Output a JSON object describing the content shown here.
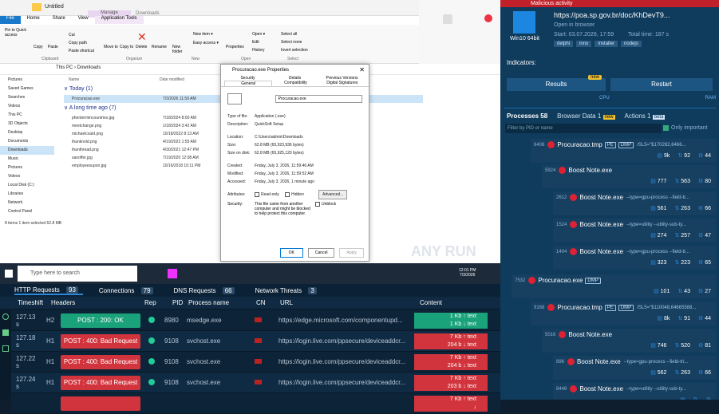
{
  "explorer": {
    "title": "Untitled",
    "manage": "Manage",
    "downloads_title": "Downloads",
    "tabs": [
      "File",
      "Home",
      "Share",
      "View",
      "Application Tools"
    ],
    "ribbon": {
      "pin": "Pin to Quick access",
      "copy": "Copy",
      "paste": "Paste",
      "cut": "Cut",
      "copy_path": "Copy path",
      "paste_shortcut": "Paste shortcut",
      "move_to": "Move to",
      "copy_to": "Copy to",
      "delete": "Delete",
      "rename": "Rename",
      "new_folder": "New folder",
      "new_item": "New item ▾",
      "easy_access": "Easy access ▾",
      "properties": "Properties",
      "open": "Open ▾",
      "edit": "Edit",
      "history": "History",
      "select_all": "Select all",
      "select_none": "Select none",
      "invert": "Invert selection",
      "groups": [
        "Clipboard",
        "Organize",
        "New",
        "Open",
        "Select"
      ]
    },
    "path": "This PC › Downloads",
    "nav": [
      "Pictures",
      "Saved Games",
      "Searches",
      "Videos",
      "This PC",
      "3D Objects",
      "Desktop",
      "Documents",
      "Downloads",
      "Music",
      "Pictures",
      "Videos",
      "Local Disk (C:)",
      "Libraries",
      "Network",
      "Control Panel"
    ],
    "headers": [
      "Name",
      "Date modified"
    ],
    "group_today": "∨ Today (1)",
    "group_old": "∨ A long time ago (7)",
    "files_today": [
      [
        "Procuracao.exe",
        "7/3/2026 11:59 AM"
      ]
    ],
    "files_old": [
      [
        "phentermincountries.jpg",
        "7/18/2024 8:00 AM"
      ],
      [
        "meetchange.png",
        "1/18/2024 3:42 AM"
      ],
      [
        "michaelcould.png",
        "10/18/2022 8:13 AM"
      ],
      [
        "thanknoid.png",
        "4/19/2022 1:55 AM"
      ],
      [
        "thanthread.png",
        "4/30/2021 12:47 PM"
      ],
      [
        "sanoffer.jpg",
        "7/19/2020 12:08 AM"
      ],
      [
        "employeesupon.jpg",
        "10/16/2018 10:11 PM"
      ]
    ],
    "status": "8 items    1 item selected  62.8 MB"
  },
  "dialog": {
    "title": "Procuracao.exe Properties",
    "tabs_top": [
      "Security",
      "Details",
      "Previous Versions"
    ],
    "tabs_bottom": [
      "General",
      "Compatibility",
      "Digital Signatures"
    ],
    "name": "Procuracao.exe",
    "props": [
      [
        "Type of file:",
        "Application (.exe)"
      ],
      [
        "Description:",
        "QuickSoft Setup"
      ],
      [
        "Location:",
        "C:\\Users\\admin\\Downloads"
      ],
      [
        "Size:",
        "62.8 MB (65,923,936 bytes)"
      ],
      [
        "Size on disk:",
        "62.8 MB (65,925,120 bytes)"
      ],
      [
        "Created:",
        "Friday, July 3, 2026, 11:59:46 AM"
      ],
      [
        "Modified:",
        "Friday, July 3, 2026, 11:59:52 AM"
      ],
      [
        "Accessed:",
        "Friday, July 3, 2026, 1 minute ago"
      ]
    ],
    "attr_label": "Attributes:",
    "readonly": "Read-only",
    "hidden": "Hidden",
    "advanced": "Advanced...",
    "security_label": "Security:",
    "security_text": "This file came from another computer and might be blocked to help protect this computer.",
    "unblock": "Unblock",
    "ok": "OK",
    "cancel": "Cancel",
    "apply": "Apply"
  },
  "taskbar": {
    "search": "Type here to search",
    "time": "12:01 PM",
    "date": "7/3/2026",
    "watermark": "ANY RUN"
  },
  "panel": {
    "malicious": "Malicious activity",
    "url": "https://poa.sp.gov.br/doc/KhDevT9...",
    "open_in": "Open in browser",
    "start": "Start: 03.07.2026, 17:59",
    "total": "Total time: 187 s",
    "os": "Win10 64bit",
    "tags": [
      "delphi",
      "inno",
      "installer",
      "nodejs"
    ],
    "indicators": "Indicators:",
    "results": "Results",
    "new": "new",
    "restart": "Restart",
    "cpu": "CPU",
    "ram": "RAM",
    "tabs": [
      "Processes 58",
      "Browser Data 1",
      "Actions 1"
    ],
    "beta": "beta",
    "filter": "Filter by PID or name",
    "only": "Only important",
    "procs": [
      {
        "pid": "6408",
        "name": "Procuracao.tmp",
        "chips": [
          "PE",
          "DMP"
        ],
        "args": "/SL5=\"$170282,6466...",
        "f": "9k",
        "n": "92",
        "g": "44"
      },
      {
        "pid": "5924",
        "name": "Boost Note.exe",
        "chips": [],
        "args": "",
        "f": "777",
        "n": "563",
        "g": "80"
      },
      {
        "pid": "2612",
        "name": "Boost Note.exe",
        "chips": [],
        "args": "--type=gpu-process --field-tr...",
        "f": "561",
        "n": "263",
        "g": "66"
      },
      {
        "pid": "1524",
        "name": "Boost Note.exe",
        "chips": [],
        "args": "--type=utility --utility-sub-ty...",
        "f": "274",
        "n": "257",
        "g": "47"
      },
      {
        "pid": "1404",
        "name": "Boost Note.exe",
        "chips": [],
        "args": "--type=gpu-process --field-tr...",
        "f": "323",
        "n": "223",
        "g": "65"
      },
      {
        "pid": "7532",
        "name": "Procuracao.exe",
        "chips": [
          "DMP"
        ],
        "args": "",
        "f": "101",
        "n": "43",
        "g": "27"
      },
      {
        "pid": "9168",
        "name": "Procuracao.tmp",
        "chips": [
          "PE",
          "DMP"
        ],
        "args": "/SL5=\"$110048,64665588...",
        "f": "8k",
        "n": "91",
        "g": "44"
      },
      {
        "pid": "5016",
        "name": "Boost Note.exe",
        "chips": [],
        "args": "",
        "f": "746",
        "n": "520",
        "g": "81"
      },
      {
        "pid": "896",
        "name": "Boost Note.exe",
        "chips": [],
        "args": "--type=gpu-process --field-tri...",
        "f": "562",
        "n": "263",
        "g": "66"
      },
      {
        "pid": "8448",
        "name": "Boost Note.exe",
        "chips": [],
        "args": "--type=utility --utility-sub-ty...",
        "f": "",
        "n": "",
        "g": ""
      }
    ]
  },
  "net": {
    "tabs": [
      [
        "HTTP Requests",
        "93"
      ],
      [
        "Connections",
        "79"
      ],
      [
        "DNS Requests",
        "66"
      ],
      [
        "Network Threats",
        "3"
      ]
    ],
    "headers": [
      "Timeshift",
      "Headers",
      "Rep",
      "PID",
      "Process name",
      "CN",
      "URL",
      "Content"
    ],
    "rows": [
      [
        "127.13 s",
        "H2",
        "POST : 200: OK",
        "8980",
        "msedge.exe",
        "https://edge.microsoft.com/componentupd...",
        "1 Kb",
        "1 Kb",
        "text",
        "text",
        "green"
      ],
      [
        "127.18 s",
        "H1",
        "POST : 400: Bad Request",
        "9108",
        "svchost.exe",
        "https://login.live.com/ppsecure/deviceaddcr...",
        "7 Kb",
        "204 b",
        "text",
        "text",
        "red"
      ],
      [
        "127.22 s",
        "H1",
        "POST : 400: Bad Request",
        "9108",
        "svchost.exe",
        "https://login.live.com/ppsecure/deviceaddcr...",
        "7 Kb",
        "204 b",
        "text",
        "text",
        "red"
      ],
      [
        "127.24 s",
        "H1",
        "POST : 400: Bad Request",
        "9108",
        "svchost.exe",
        "https://login.live.com/ppsecure/deviceaddcr...",
        "7 Kb",
        "203 b",
        "text",
        "text",
        "red"
      ],
      [
        "",
        "",
        "",
        "",
        "",
        "",
        "7 Kb",
        "",
        "text",
        "",
        "red"
      ]
    ]
  }
}
